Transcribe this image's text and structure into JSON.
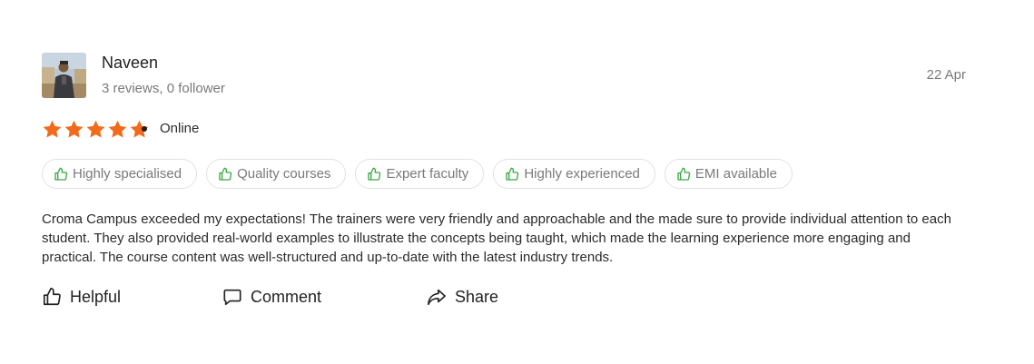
{
  "review": {
    "author": "Naveen",
    "author_meta": "3 reviews, 0 follower",
    "date": "22 Apr",
    "rating": 5,
    "rating_max": 5,
    "mode": "Online",
    "tags": [
      "Highly specialised",
      "Quality courses",
      "Expert faculty",
      "Highly experienced",
      "EMI available"
    ],
    "text": "Croma Campus exceeded my expectations! The trainers were very friendly and approachable and the made sure to provide individual attention to each student. They also provided real-world examples to illustrate the concepts being taught, which made the learning experience more engaging and practical. The course content was well-structured and up-to-date with the latest industry trends."
  },
  "actions": {
    "helpful": "Helpful",
    "comment": "Comment",
    "share": "Share"
  },
  "colors": {
    "star": "#f26a1b",
    "tag_icon": "#3aa845",
    "tag_border": "#e2e2e2",
    "muted_text": "#7a7a7a"
  },
  "icons": {
    "avatar": "user-photo",
    "tag": "thumbs-up-icon",
    "helpful": "thumbs-up-icon",
    "comment": "comment-icon",
    "share": "share-icon"
  }
}
